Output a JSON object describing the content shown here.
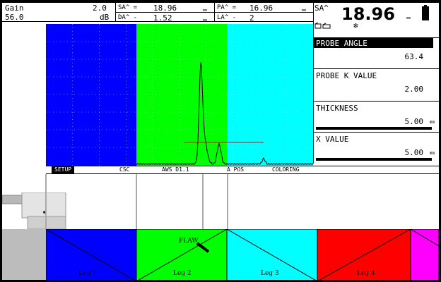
{
  "header": {
    "gain_label": "Gain",
    "gain_value": "2.0",
    "gain_db": "56.0",
    "gain_unit": "dB",
    "sa_label": "SA^ =",
    "sa_value": "18.96",
    "sa_unit": "mm",
    "da_label": "DA^ -",
    "da_value": "1.52",
    "da_unit": "mm",
    "pa_label": "PA^ =",
    "pa_value": "16.96",
    "pa_unit": "mm",
    "la_label": "LA^ -",
    "la_value": "2",
    "big_label": "SA^",
    "big_value": "18.96",
    "big_unit": "mm"
  },
  "menu": {
    "setup": "SETUP",
    "csc": "CSC",
    "aws": "AWS D1.1",
    "apos": "A POS",
    "coloring": "COLORING"
  },
  "panels": {
    "probe_angle_label": "PROBE ANGLE",
    "probe_angle_value": "63.4",
    "probe_k_label": "PROBE K VALUE",
    "probe_k_value": "2.00",
    "thickness_label": "THICKNESS",
    "thickness_value": "5.00",
    "thickness_unit": "mm",
    "xvalue_label": "X VALUE",
    "xvalue_value": "5.00",
    "xvalue_unit": "mm"
  },
  "diagram": {
    "flaw_label": "FLAW",
    "legs": [
      "Leg 1",
      "Leg 2",
      "Leg 3",
      "Leg 4"
    ]
  },
  "colors": {
    "leg1": "#0000ff",
    "leg2": "#00ff00",
    "leg3": "#00ffff",
    "leg4": "#ff0000",
    "leg5": "#ff00ff",
    "gate": "#ff0000",
    "signal": "#000000"
  },
  "icons": [
    "battery-icon",
    "probe-status-icon",
    "freeze-icon"
  ]
}
